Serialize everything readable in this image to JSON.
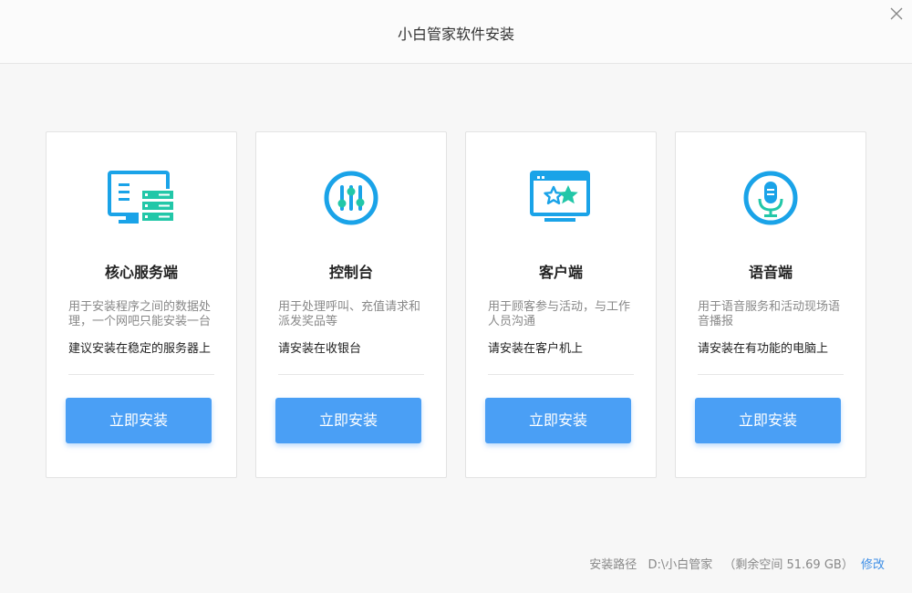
{
  "window": {
    "title": "小白管家软件安装"
  },
  "colors": {
    "accent": "#4a9ff5",
    "icon_blue": "#1aa3e8",
    "icon_green": "#22c7a8",
    "link": "#3d8ee6"
  },
  "cards": [
    {
      "icon": "server-monitor-icon",
      "name": "核心服务端",
      "desc": "用于安装程序之间的数据处理，一个网吧只能安装一台",
      "tip": "建议安装在稳定的服务器上",
      "button": "立即安装"
    },
    {
      "icon": "sliders-icon",
      "name": "控制台",
      "desc": "用于处理呼叫、充值请求和派发奖品等",
      "tip": "请安装在收银台",
      "button": "立即安装"
    },
    {
      "icon": "star-monitor-icon",
      "name": "客户端",
      "desc": "用于顾客参与活动，与工作人员沟通",
      "tip": "请安装在客户机上",
      "button": "立即安装"
    },
    {
      "icon": "microphone-icon",
      "name": "语音端",
      "desc": "用于语音服务和活动现场语音播报",
      "tip": "请安装在有功能的电脑上",
      "button": "立即安装"
    }
  ],
  "footer": {
    "label": "安装路径",
    "path": "D:\\小白管家",
    "free_space": "（剩余空间 51.69 GB）",
    "modify": "修改"
  }
}
